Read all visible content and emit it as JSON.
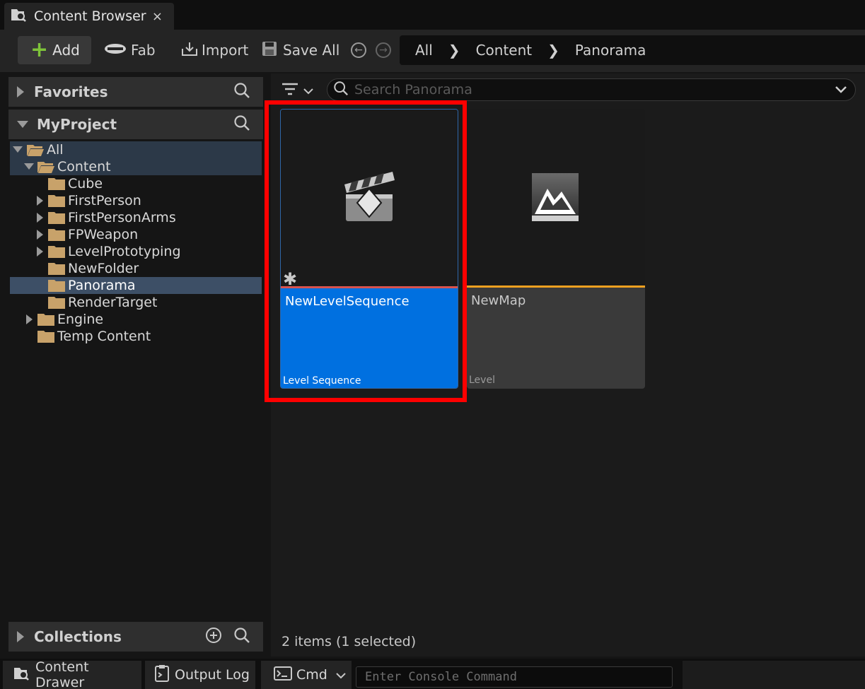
{
  "tab": {
    "title": "Content Browser",
    "close": "×"
  },
  "toolbar": {
    "add_label": "Add",
    "fab_label": "Fab",
    "import_label": "Import",
    "save_all_label": "Save All"
  },
  "breadcrumb": [
    "All",
    "Content",
    "Panorama"
  ],
  "sidebar": {
    "favorites_label": "Favorites",
    "project_label": "MyProject",
    "collections_label": "Collections",
    "tree": [
      {
        "label": "All"
      },
      {
        "label": "Content"
      },
      {
        "label": "Cube"
      },
      {
        "label": "FirstPerson"
      },
      {
        "label": "FirstPersonArms"
      },
      {
        "label": "FPWeapon"
      },
      {
        "label": "LevelPrototyping"
      },
      {
        "label": "NewFolder"
      },
      {
        "label": "Panorama"
      },
      {
        "label": "RenderTarget"
      },
      {
        "label": "Engine"
      },
      {
        "label": "Temp Content"
      }
    ]
  },
  "search": {
    "placeholder": "Search Panorama"
  },
  "assets": [
    {
      "name": "NewLevelSequence",
      "type": "Level Sequence"
    },
    {
      "name": "NewMap",
      "type": "Level"
    }
  ],
  "status": "2 items (1 selected)",
  "bottom": {
    "content_drawer": "Content Drawer",
    "output_log": "Output Log",
    "cmd": "Cmd",
    "console_placeholder": "Enter Console Command"
  },
  "colors": {
    "selection_blue": "#0070e0",
    "level_sequence_bar": "#d9534f",
    "level_bar": "#f0a020",
    "folder": "#c8a26a",
    "highlight_red": "#ff0000"
  }
}
